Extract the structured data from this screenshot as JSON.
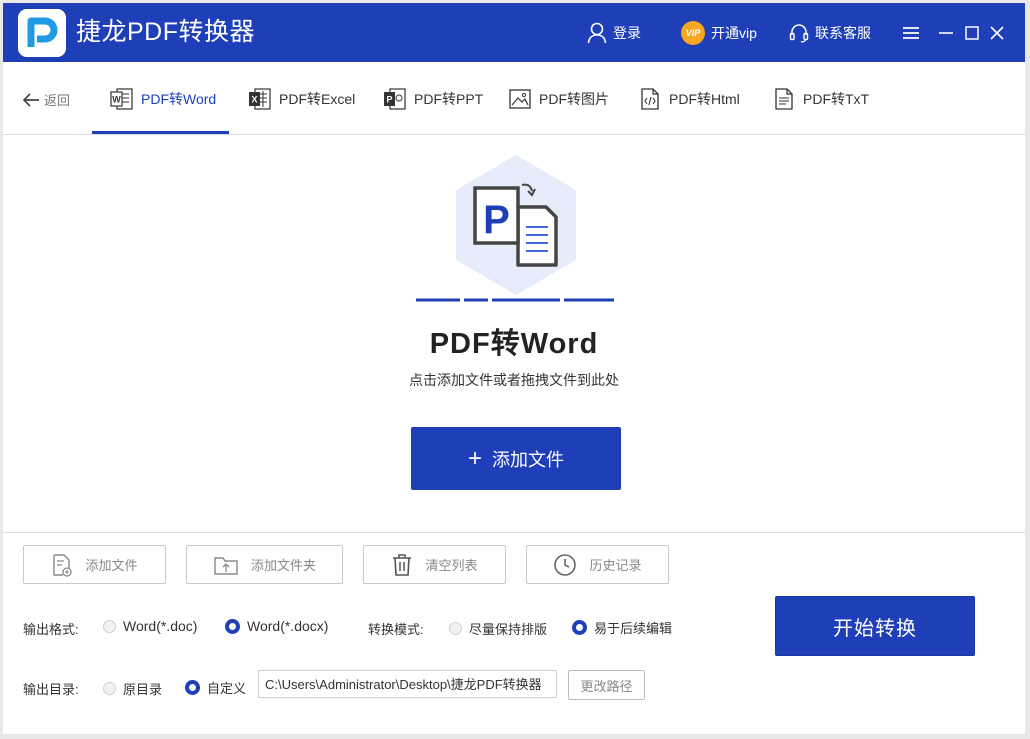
{
  "app": {
    "title": "捷龙PDF转换器"
  },
  "titlebar": {
    "login_label": "登录",
    "vip_badge": "VIP",
    "vip_label": "开通vip",
    "support_label": "联系客服"
  },
  "tabbar": {
    "back_label": "返回",
    "tabs": [
      {
        "label": "PDF转Word",
        "active": true
      },
      {
        "label": "PDF转Excel"
      },
      {
        "label": "PDF转PPT"
      },
      {
        "label": "PDF转图片"
      },
      {
        "label": "PDF转Html"
      },
      {
        "label": "PDF转TxT"
      }
    ]
  },
  "main": {
    "title": "PDF转Word",
    "subtitle": "点击添加文件或者拖拽文件到此处",
    "add_button": "添加文件",
    "hero_letter": "P"
  },
  "toolbar": {
    "add_file": "添加文件",
    "add_folder": "添加文件夹",
    "clear_list": "清空列表",
    "history": "历史记录"
  },
  "options": {
    "format_label": "输出格式:",
    "format_options": [
      "Word(*.doc)",
      "Word(*.docx)"
    ],
    "format_selected": "Word(*.docx)",
    "mode_label": "转换模式:",
    "mode_options": [
      "尽量保持排版",
      "易于后续编辑"
    ],
    "mode_selected": "易于后续编辑",
    "dir_label": "输出目录:",
    "dir_options": [
      "原目录",
      "自定义"
    ],
    "dir_selected": "自定义",
    "path_value": "C:\\Users\\Administrator\\Desktop\\捷龙PDF转换器",
    "change_path": "更改路径",
    "start_button": "开始转换"
  },
  "colors": {
    "brand": "#1e3fb8",
    "vip": "#f5a623"
  }
}
